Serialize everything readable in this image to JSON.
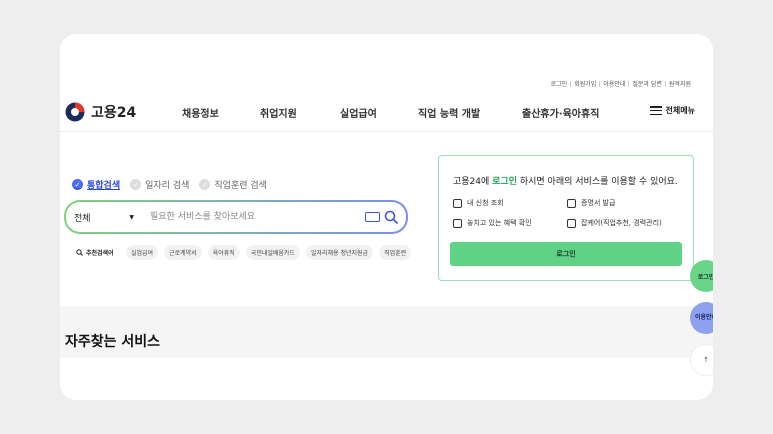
{
  "utility_links": [
    "로그인",
    "회원가입",
    "이용안내",
    "질문과 답변",
    "원격지원"
  ],
  "brand": {
    "name": "고용24"
  },
  "nav": {
    "items": [
      "채용정보",
      "취업지원",
      "실업급여",
      "직업 능력 개발",
      "출산휴가·육아휴직"
    ],
    "all_menu": "전체메뉴"
  },
  "search": {
    "tabs": [
      "통합검색",
      "일자리 검색",
      "직업훈련 검색"
    ],
    "active_tab": "통합검색",
    "select_value": "전체",
    "placeholder": "필요한 서비스를 찾아보세요",
    "recommended_label": "추천검색어",
    "chips": [
      "실업급여",
      "근로계약서",
      "육아휴직",
      "국민내일배움카드",
      "일자리채용 청년지원금",
      "직업훈련"
    ]
  },
  "login_panel": {
    "title_pre": "고용24에 ",
    "title_link": "로그인",
    "title_post": " 하시면 아래의 서비스를 이용할 수 있어요.",
    "items": [
      "내 신청 조회",
      "증명서 발급",
      "놓치고 있는 혜택 확인",
      "잡케어(직업추천, 경력관리)"
    ],
    "button": "로그인"
  },
  "favorites": {
    "title": "자주찾는 서비스"
  },
  "floating": {
    "login": "로그인",
    "guide": "이용안내",
    "top": "↑"
  },
  "colors": {
    "accent_green": "#5fd286",
    "accent_blue": "#4a6cf0"
  }
}
